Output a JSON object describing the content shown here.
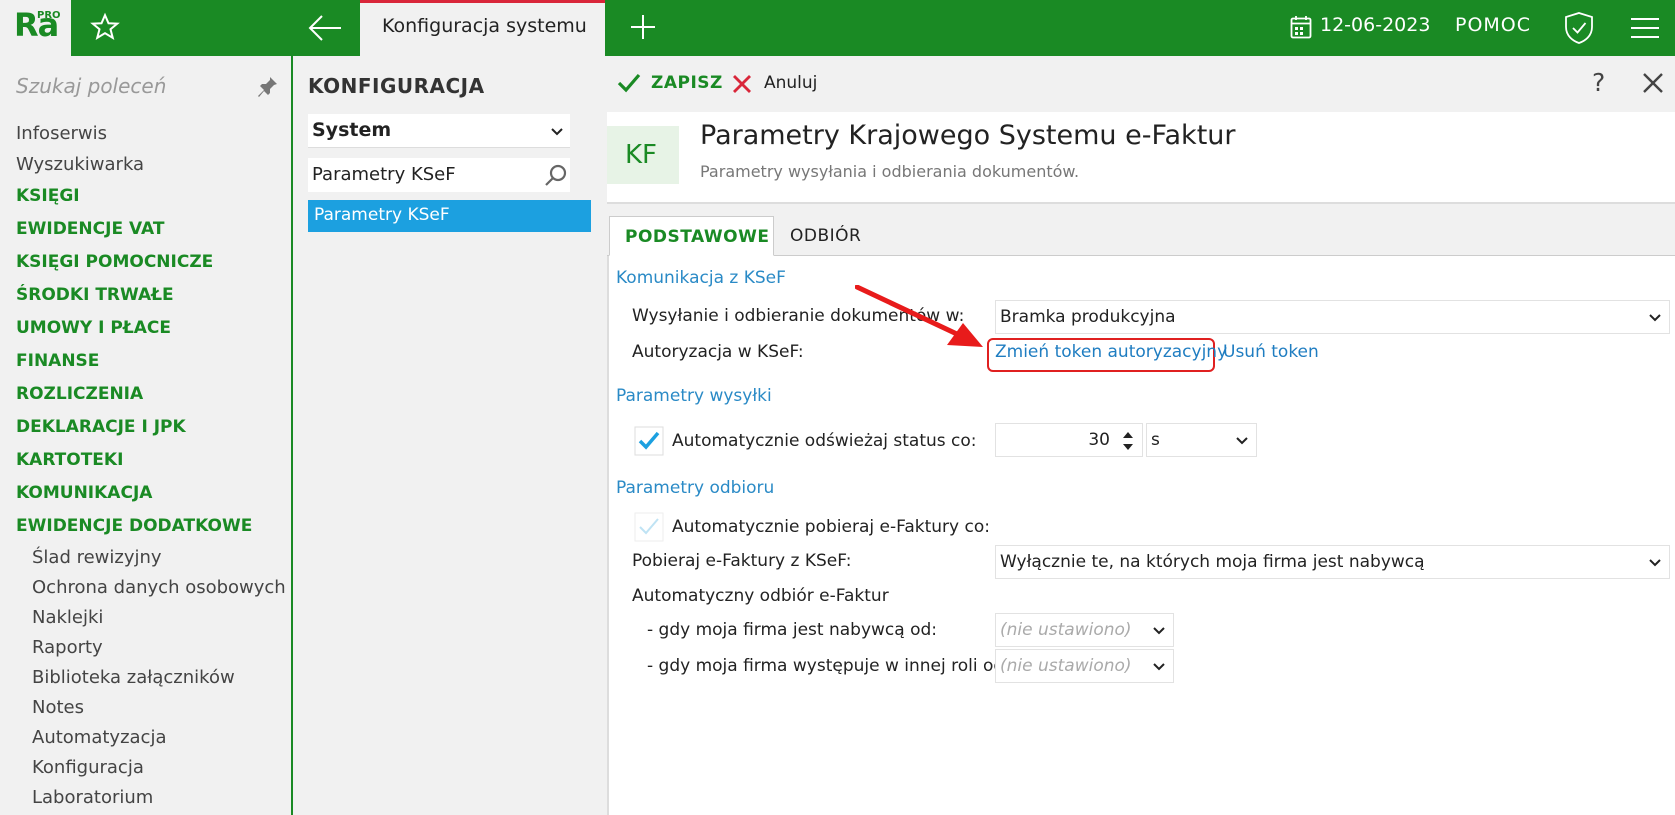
{
  "topbar": {
    "logo": "Ra",
    "logo_badge": "PRO",
    "tab_title": "Konfiguracja systemu",
    "date": "12-06-2023",
    "help": "POMOC"
  },
  "sidebar": {
    "search_placeholder": "Szukaj poleceń",
    "items": [
      {
        "label": "Infoserwis"
      },
      {
        "label": "Wyszukiwarka"
      },
      {
        "label": "KSIĘGI"
      },
      {
        "label": "EWIDENCJE VAT"
      },
      {
        "label": "KSIĘGI POMOCNICZE"
      },
      {
        "label": "ŚRODKI TRWAŁE"
      },
      {
        "label": "UMOWY I PŁACE"
      },
      {
        "label": "FINANSE"
      },
      {
        "label": "ROZLICZENIA"
      },
      {
        "label": "DEKLARACJE I JPK"
      },
      {
        "label": "KARTOTEKI"
      },
      {
        "label": "KOMUNIKACJA"
      },
      {
        "label": "EWIDENCJE DODATKOWE"
      },
      {
        "label": "Ślad rewizyjny"
      },
      {
        "label": "Ochrona danych osobowych"
      },
      {
        "label": "Naklejki"
      },
      {
        "label": "Raporty"
      },
      {
        "label": "Biblioteka załączników"
      },
      {
        "label": "Notes"
      },
      {
        "label": "Automatyzacja"
      },
      {
        "label": "Konfiguracja"
      },
      {
        "label": "Laboratorium"
      }
    ]
  },
  "config": {
    "title": "KONFIGURACJA",
    "select_value": "System",
    "search_value": "Parametry KSeF",
    "active_item": "Parametry KSeF"
  },
  "toolbar": {
    "save_label": "ZAPISZ",
    "cancel_label": "Anuluj",
    "help_label": "?"
  },
  "header": {
    "badge": "KF",
    "title": "Parametry Krajowego Systemu e-Faktur",
    "subtitle": "Parametry wysyłania i odbierania dokumentów."
  },
  "tabs": [
    {
      "label": "PODSTAWOWE"
    },
    {
      "label": "ODBIÓR"
    }
  ],
  "form": {
    "section_comm": "Komunikacja z KSeF",
    "send_label": "Wysyłanie i odbieranie dokumentów w:",
    "send_value": "Bramka produkcyjna",
    "auth_label": "Autoryzacja w KSeF:",
    "auth_change_link": "Zmień token autoryzacyjny",
    "auth_remove_link": "Usuń token",
    "section_send": "Parametry wysyłki",
    "refresh_label": "Automatycznie odświeżaj status co:",
    "refresh_value": "30",
    "refresh_unit": "s",
    "section_recv": "Parametry odbioru",
    "auto_fetch_label": "Automatycznie pobieraj e-Faktury co:",
    "fetch_from_label": "Pobieraj e-Faktury z KSeF:",
    "fetch_from_value": "Wyłącznie te, na których moja firma jest nabywcą",
    "auto_recv_label": "Automatyczny odbiór e-Faktur",
    "buyer_label": "- gdy moja firma jest nabywcą od:",
    "buyer_value": "(nie ustawiono)",
    "other_role_label": "- gdy moja firma występuje w innej roli od:",
    "other_role_value": "(nie ustawiono)"
  },
  "colors": {
    "brand_green": "#1a8a24",
    "accent_blue": "#1ca0e0",
    "link_blue": "#1f7dc1",
    "highlight_red": "#e02020"
  }
}
